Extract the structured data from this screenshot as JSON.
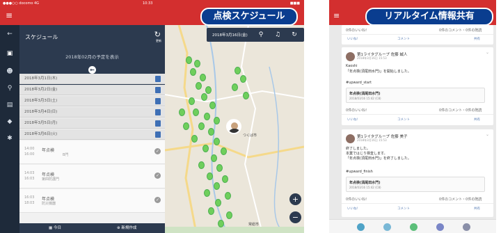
{
  "banners": {
    "left": "点検スケジュール",
    "right": "リアルタイム情報共有"
  },
  "tablet": {
    "status": {
      "carrier": "●●●○○ docomo 4G",
      "time": "10:33",
      "battery": "■■■"
    },
    "sidebar": {
      "title": "スケジュール",
      "refresh_label": "更新",
      "month_label": "2018年02月の予定を表示",
      "days": [
        "2018年3月1日(木)",
        "2018年3月2日(金)",
        "2018年3月3日(土)",
        "2018年3月4日(日)",
        "2018年3月5日(月)",
        "2018年3月6日(火)"
      ],
      "tasks": [
        {
          "start": "14:00",
          "end": "16:00",
          "name": "年点検",
          "sub": "B門"
        },
        {
          "start": "14:03",
          "end": "16:03",
          "name": "年点検",
          "sub": "第四防護門"
        },
        {
          "start": "16:03",
          "end": "18:03",
          "name": "年点検",
          "sub": "防災機器"
        }
      ],
      "footer_today": "今日",
      "footer_new": "新規作成"
    },
    "map": {
      "date": "2018年3月16日(金)",
      "label_tsukuba": "つくば市",
      "label_town": "常総市",
      "zoom_in": "+",
      "zoom_out": "−"
    }
  },
  "phone": {
    "cards": [
      {
        "name": "第1ライタグループ 佐藤 誠人",
        "time": "2018年3月16日 15:53",
        "body1": "Kaoshi",
        "body2": "「年点検(須尾田水門)」を開始しました。",
        "tag": "#upward_start",
        "box_title": "年点検(須尾田水門)",
        "box_sub": "2018/03/16 15:42 (C8)",
        "meta_left": "0件のいいね!",
        "meta_right": "0件のコメント・0件の既読",
        "like": "いいね!",
        "comment": "コメント",
        "share": "共有"
      },
      {
        "name": "第1ライタグループ 佐藤 美子",
        "time": "2018年3月16日 15:53",
        "body1": "終了しました。",
        "body2": "本業ではじり検査します。",
        "body3": "「年点検(須尾田水門)」を終了しました。",
        "tag": "#upward_finish",
        "box_title": "年点検(須尾田水門)",
        "box_sub": "2018/03/16 15:42 (C8)",
        "meta_left": "0件のいいね!",
        "meta_right": "0件のコメント・0件の既読",
        "like": "いいね!",
        "comment": "コメント",
        "share": "共有"
      }
    ],
    "top_meta_left": "0件のいいね!",
    "top_meta_right": "0件のコメント・0件の既読",
    "top_like": "いいね!",
    "top_comment": "コメント",
    "top_share": "共有"
  },
  "colors": {
    "header_red": "#d32f2f",
    "banner_blue": "#0a3d8f",
    "navy": "#2c3a4f",
    "pin_green": "#6fcf5c"
  }
}
